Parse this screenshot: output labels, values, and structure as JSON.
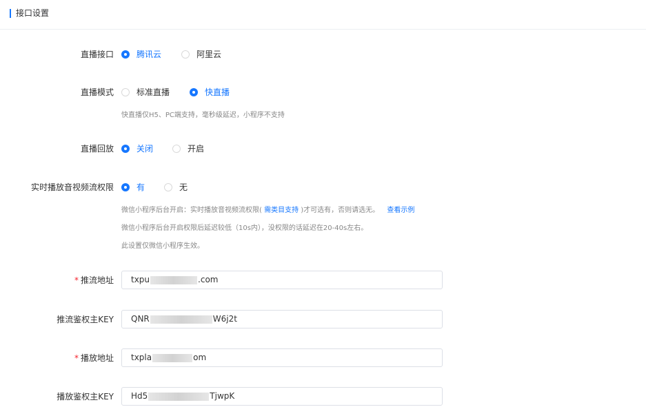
{
  "header": {
    "title": "接口设置"
  },
  "colors": {
    "accent": "#1677ff",
    "required": "#f5222d"
  },
  "form": {
    "live_api": {
      "label": "直播接口",
      "options": [
        {
          "label": "腾讯云",
          "checked": true
        },
        {
          "label": "阿里云",
          "checked": false
        }
      ]
    },
    "live_mode": {
      "label": "直播模式",
      "options": [
        {
          "label": "标准直播",
          "checked": false
        },
        {
          "label": "快直播",
          "checked": true
        }
      ],
      "hint": "快直播仅H5、PC端支持，毫秒级延迟，小程序不支持"
    },
    "live_replay": {
      "label": "直播回放",
      "options": [
        {
          "label": "关闭",
          "checked": true
        },
        {
          "label": "开启",
          "checked": false
        }
      ]
    },
    "realtime_permission": {
      "label": "实时播放音视频流权限",
      "options": [
        {
          "label": "有",
          "checked": true
        },
        {
          "label": "无",
          "checked": false
        }
      ],
      "hint1_prefix": "微信小程序后台开启：实时播放音视频流权限(",
      "hint1_link": " 需类目支持 ",
      "hint1_suffix": ")才可选有，否则请选无。",
      "hint1_example": "查看示例",
      "hint2": "微信小程序后台开启权限后延迟较低（10s内），没权限的话延迟在20-40s左右。",
      "hint3": "此设置仅微信小程序生效。"
    },
    "push_url": {
      "label": "推流地址",
      "required": "*",
      "value_prefix": "txpu",
      "value_suffix": ".com"
    },
    "push_key": {
      "label": "推流鉴权主KEY",
      "value_prefix": "QNR",
      "value_suffix": "W6j2t"
    },
    "play_url": {
      "label": "播放地址",
      "required": "*",
      "value_prefix": "txpla",
      "value_suffix": "om"
    },
    "play_key": {
      "label": "播放鉴权主KEY",
      "value_prefix": "Hd5",
      "value_suffix": "TjwpK"
    }
  }
}
